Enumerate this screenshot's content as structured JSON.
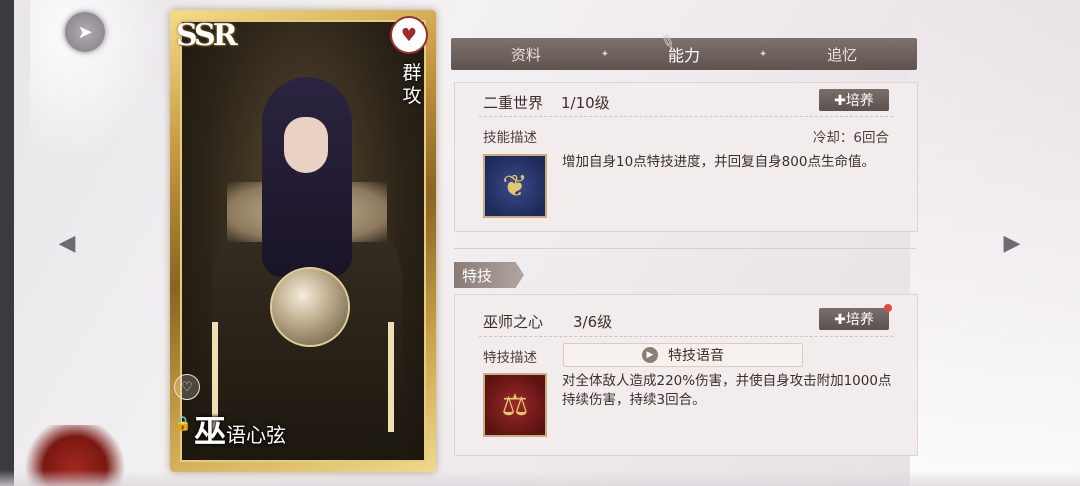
{
  "card": {
    "rarity": "SSR",
    "attack_type": "群攻",
    "name_big": "巫",
    "name_small": "语心弦"
  },
  "tabs": [
    {
      "label": "资料",
      "active": false
    },
    {
      "label": "能力",
      "active": true
    },
    {
      "label": "追忆",
      "active": false
    }
  ],
  "skill": {
    "name": "二重世界",
    "level": "1/10级",
    "cultivate_label": "✚培养",
    "desc_label": "技能描述",
    "cooldown": "冷却：6回合",
    "description": "增加自身10点特技进度，并回复自身800点生命值。",
    "icon": "leaf-moon-icon"
  },
  "special": {
    "section_label": "特技",
    "name": "巫师之心",
    "level": "3/6级",
    "cultivate_label": "✚培养",
    "desc_label": "特技描述",
    "voice_label": "特技语音",
    "description": "对全体敌人造成220%伤害，并使自身攻击附加1000点持续伤害，持续3回合。",
    "icon": "scales-icon",
    "has_notification": true
  },
  "colors": {
    "tab_bar": "#6f6360",
    "panel_bg": "#f2edec",
    "button_bg": "#6b605c",
    "notification": "#e14a3d",
    "card_gold": "#c79b43"
  }
}
